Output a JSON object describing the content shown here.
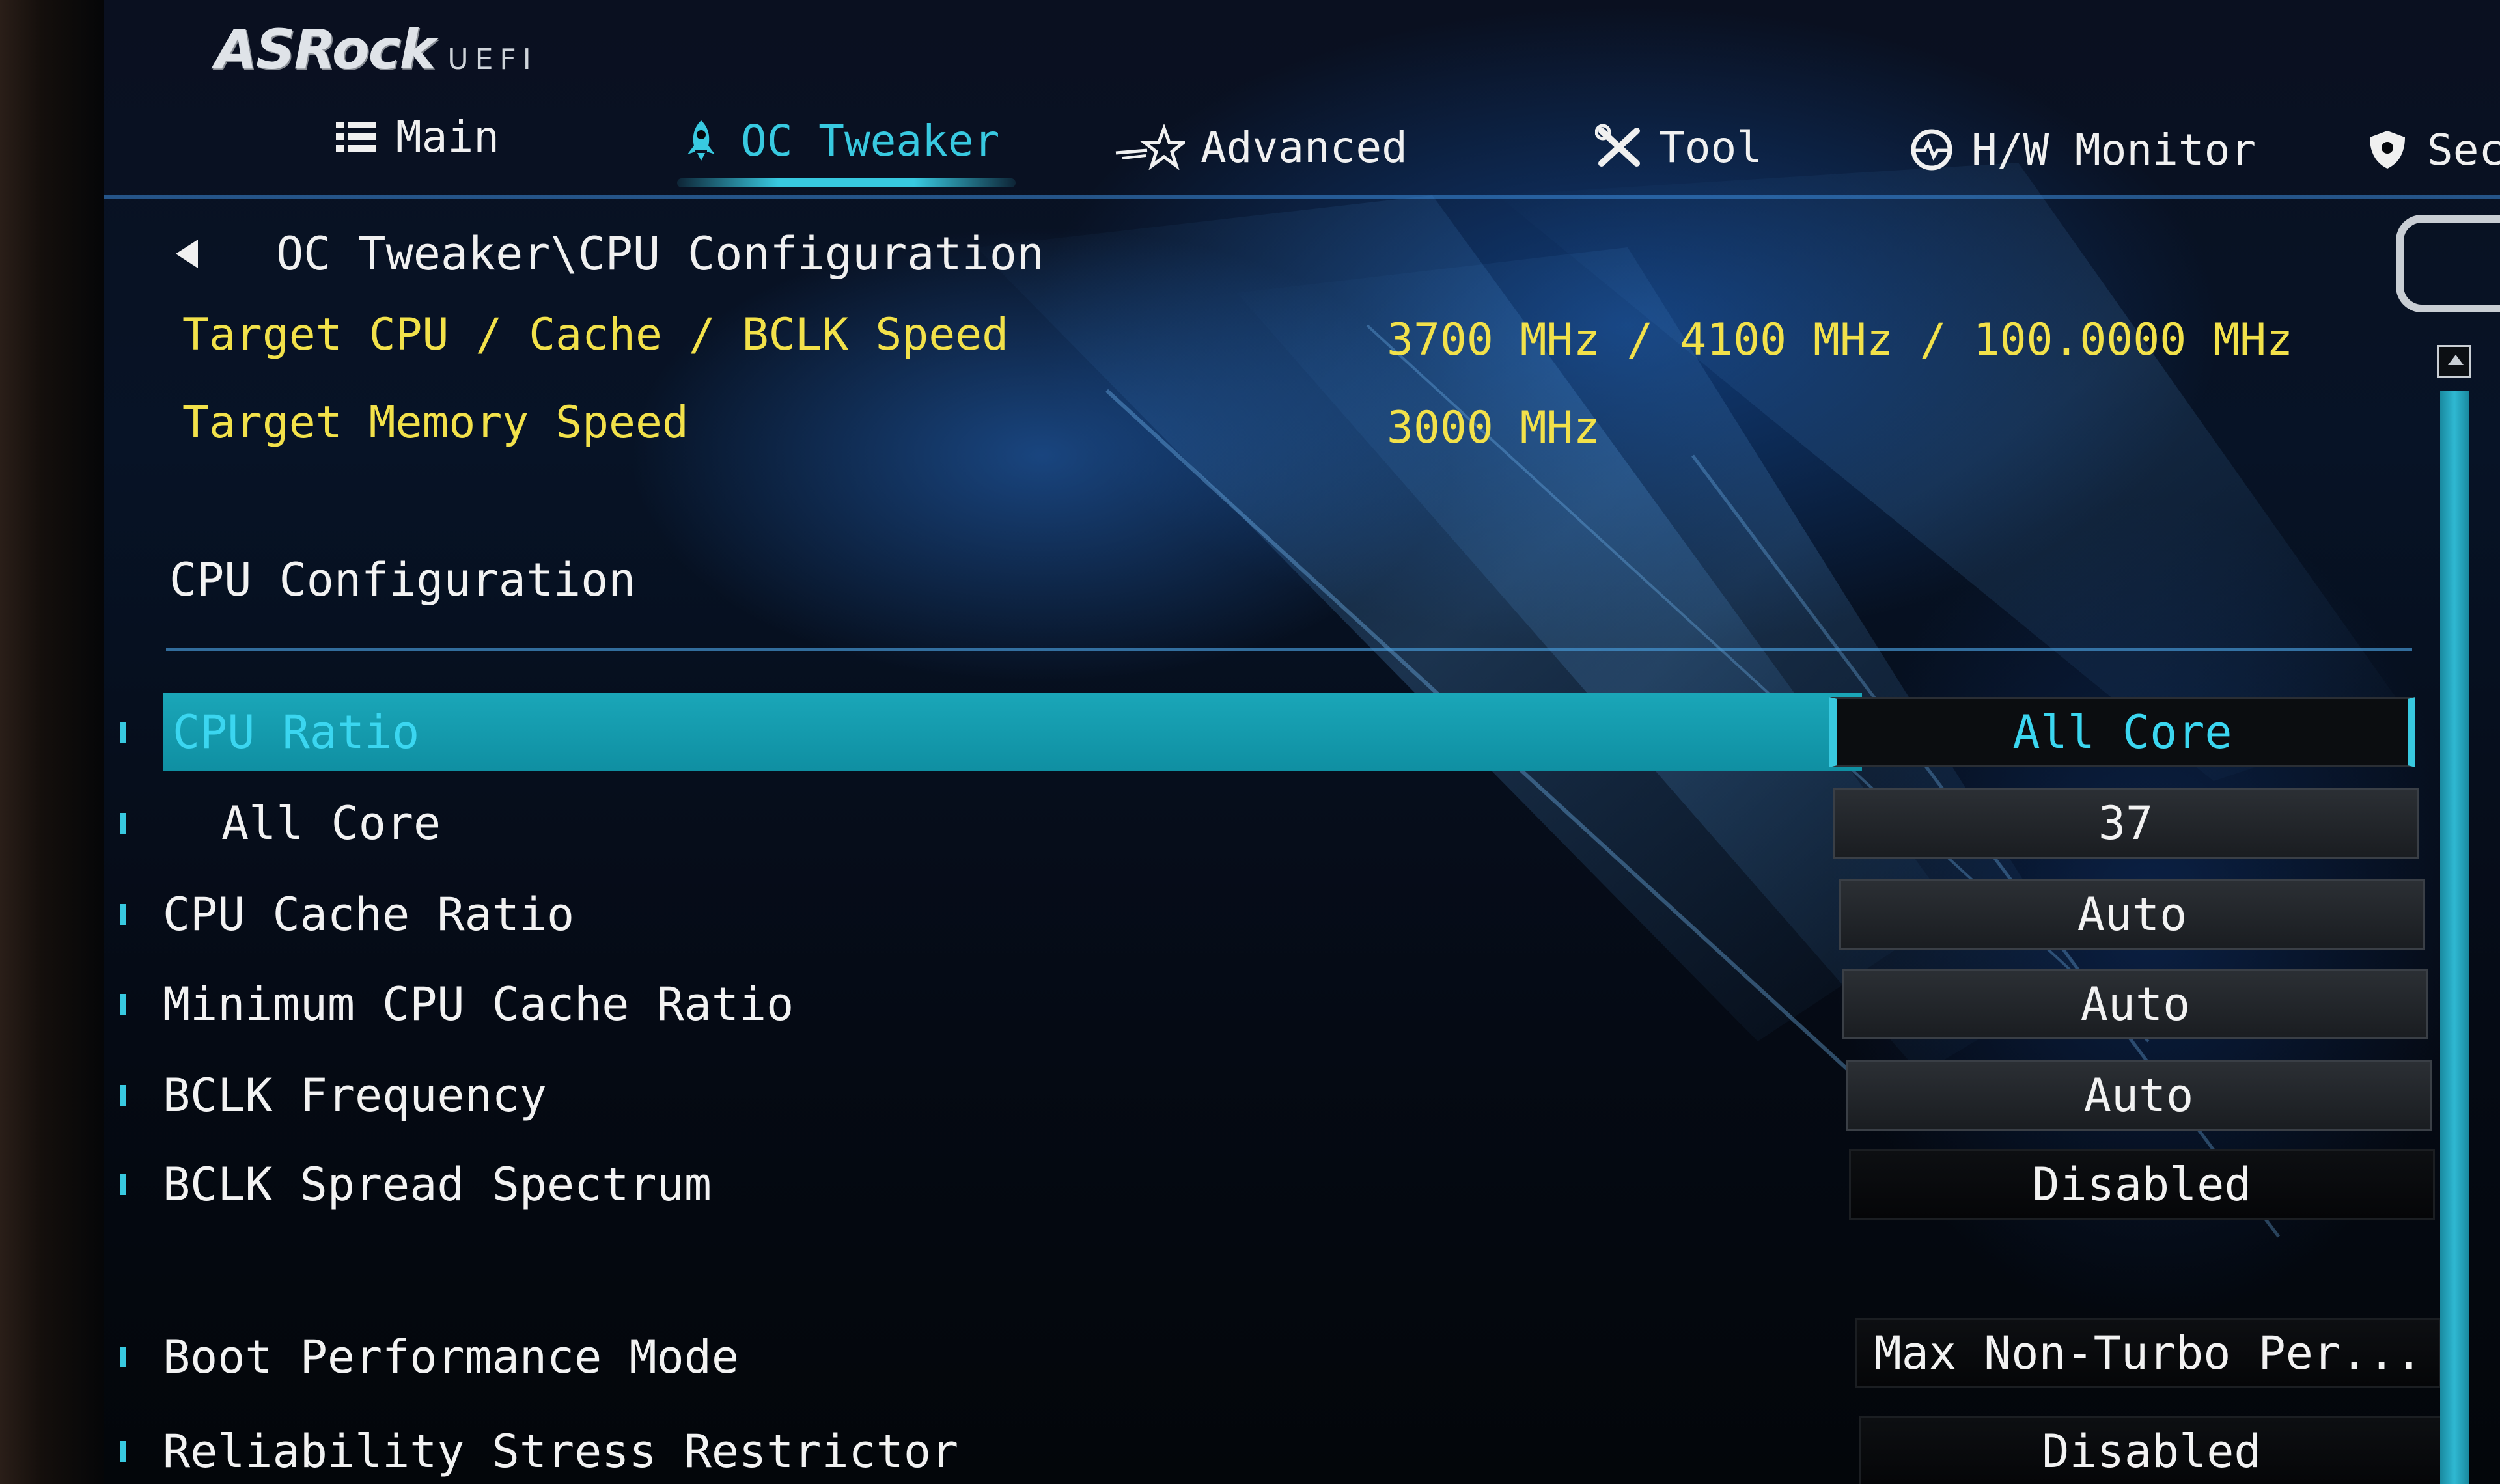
{
  "logo": {
    "brand": "ASRock",
    "sub": "UEFI"
  },
  "tabs": [
    {
      "label": "Main",
      "icon": "list-icon",
      "active": false
    },
    {
      "label": "OC Tweaker",
      "icon": "rocket-icon",
      "active": true
    },
    {
      "label": "Advanced",
      "icon": "star-icon",
      "active": false
    },
    {
      "label": "Tool",
      "icon": "tools-icon",
      "active": false
    },
    {
      "label": "H/W Monitor",
      "icon": "monitor-icon",
      "active": false
    },
    {
      "label": "Sec",
      "icon": "shield-icon",
      "active": false
    }
  ],
  "breadcrumb": "OC Tweaker\\CPU Configuration",
  "targets": [
    {
      "label": "Target CPU / Cache / BCLK Speed",
      "value": "3700 MHz / 4100 MHz / 100.0000 MHz"
    },
    {
      "label": "Target Memory Speed",
      "value": "3000 MHz"
    }
  ],
  "section_title": "CPU Configuration",
  "settings": [
    {
      "label": "CPU Ratio",
      "value": "All Core",
      "selected": true
    },
    {
      "label": "All Core",
      "value": "37",
      "indent": true
    },
    {
      "label": "CPU Cache Ratio",
      "value": "Auto"
    },
    {
      "label": "Minimum CPU Cache Ratio",
      "value": "Auto"
    },
    {
      "label": "BCLK Frequency",
      "value": "Auto"
    },
    {
      "label": "BCLK Spread Spectrum",
      "value": "Disabled"
    },
    {
      "label": "Boot Performance Mode",
      "value": "Max Non-Turbo Per..."
    },
    {
      "label": "Reliability Stress Restrictor",
      "value": "Disabled"
    }
  ],
  "colors": {
    "accent": "#38c9e0",
    "target_text": "#f2e14a",
    "selected_bar": "#1aa6b8"
  }
}
